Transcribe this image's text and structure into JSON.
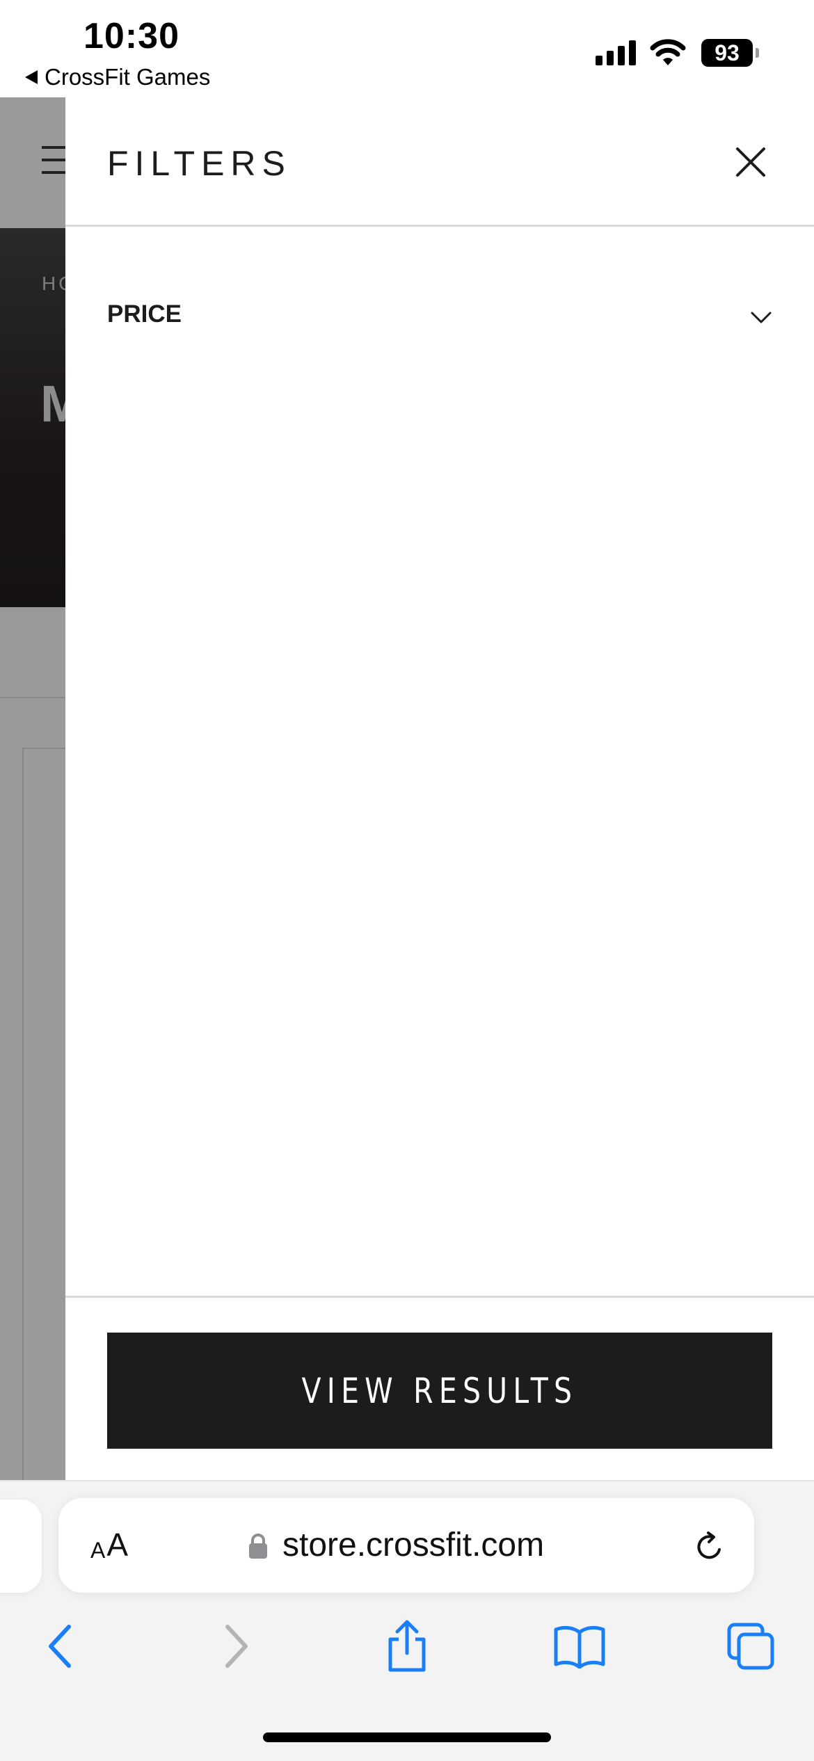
{
  "status_bar": {
    "time": "10:30",
    "back_app_label": "CrossFit Games",
    "battery_level": "93",
    "signal_icon": "cellular-signal-icon",
    "wifi_icon": "wifi-icon"
  },
  "background_page": {
    "breadcrumb_partial": "HO",
    "heading_partial": "M"
  },
  "filters": {
    "title": "FILTERS",
    "close_icon": "close-icon",
    "sections": [
      {
        "label": "PRICE",
        "expanded": false,
        "icon": "chevron-down-icon"
      }
    ],
    "view_results_label": "VIEW RESULTS"
  },
  "browser": {
    "text_size_small": "A",
    "text_size_large": "A",
    "url": "store.crossfit.com",
    "secure": true,
    "toolbar_icons": [
      "back-icon",
      "forward-icon",
      "share-icon",
      "bookmarks-icon",
      "tabs-icon"
    ]
  },
  "colors": {
    "button_bg": "#1c1c1c",
    "safari_blue": "#1a7ef7",
    "disabled_gray": "#b3b3b3"
  }
}
